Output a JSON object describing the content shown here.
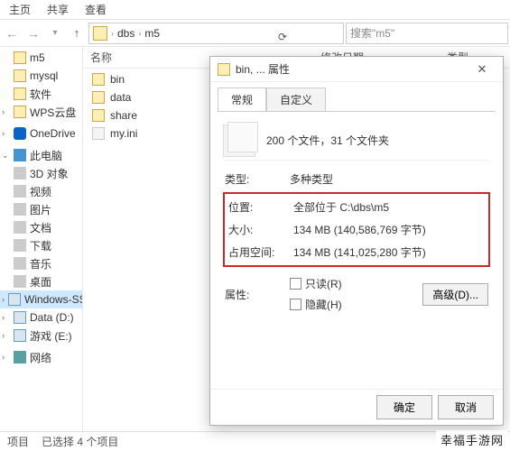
{
  "ribbon": {
    "tab_home": "主页",
    "tab_share": "共享",
    "tab_view": "查看"
  },
  "address": {
    "seg1": "dbs",
    "seg2": "m5"
  },
  "search": {
    "placeholder": "搜索\"m5\""
  },
  "columns": {
    "name": "名称",
    "date": "修改日期",
    "type": "类型"
  },
  "files": [
    {
      "name": "bin",
      "kind": "folder"
    },
    {
      "name": "data",
      "kind": "folder"
    },
    {
      "name": "share",
      "kind": "folder"
    },
    {
      "name": "my.ini",
      "kind": "ini"
    }
  ],
  "sidebar": {
    "items": [
      {
        "label": "m5",
        "icon": "folder"
      },
      {
        "label": "mysql",
        "icon": "folder"
      },
      {
        "label": "软件",
        "icon": "folder"
      },
      {
        "label": "WPS云盘",
        "icon": "folder"
      }
    ],
    "onedrive": "OneDrive",
    "this_pc": "此电脑",
    "pc_items": [
      "3D 对象",
      "视频",
      "图片",
      "文档",
      "下载",
      "音乐",
      "桌面"
    ],
    "drives": [
      "Windows-SSD (C",
      "Data (D:)",
      "游戏 (E:)"
    ],
    "network": "网络"
  },
  "statusbar": {
    "items_label": "项目",
    "selected": "已选择 4 个项目"
  },
  "dialog": {
    "title": "bin, ... 属性",
    "tab_general": "常规",
    "tab_custom": "自定义",
    "summary": "200 个文件，31 个文件夹",
    "type_label": "类型:",
    "type_value": "多种类型",
    "location_label": "位置:",
    "location_value": "全部位于 C:\\dbs\\m5",
    "size_label": "大小:",
    "size_value": "134 MB (140,586,769 字节)",
    "size_on_disk_label": "占用空间:",
    "size_on_disk_value": "134 MB (141,025,280 字节)",
    "attr_label": "属性:",
    "readonly": "只读(R)",
    "hidden": "隐藏(H)",
    "advanced": "高级(D)...",
    "ok": "确定",
    "cancel": "取消"
  },
  "watermark": "幸福手游网"
}
